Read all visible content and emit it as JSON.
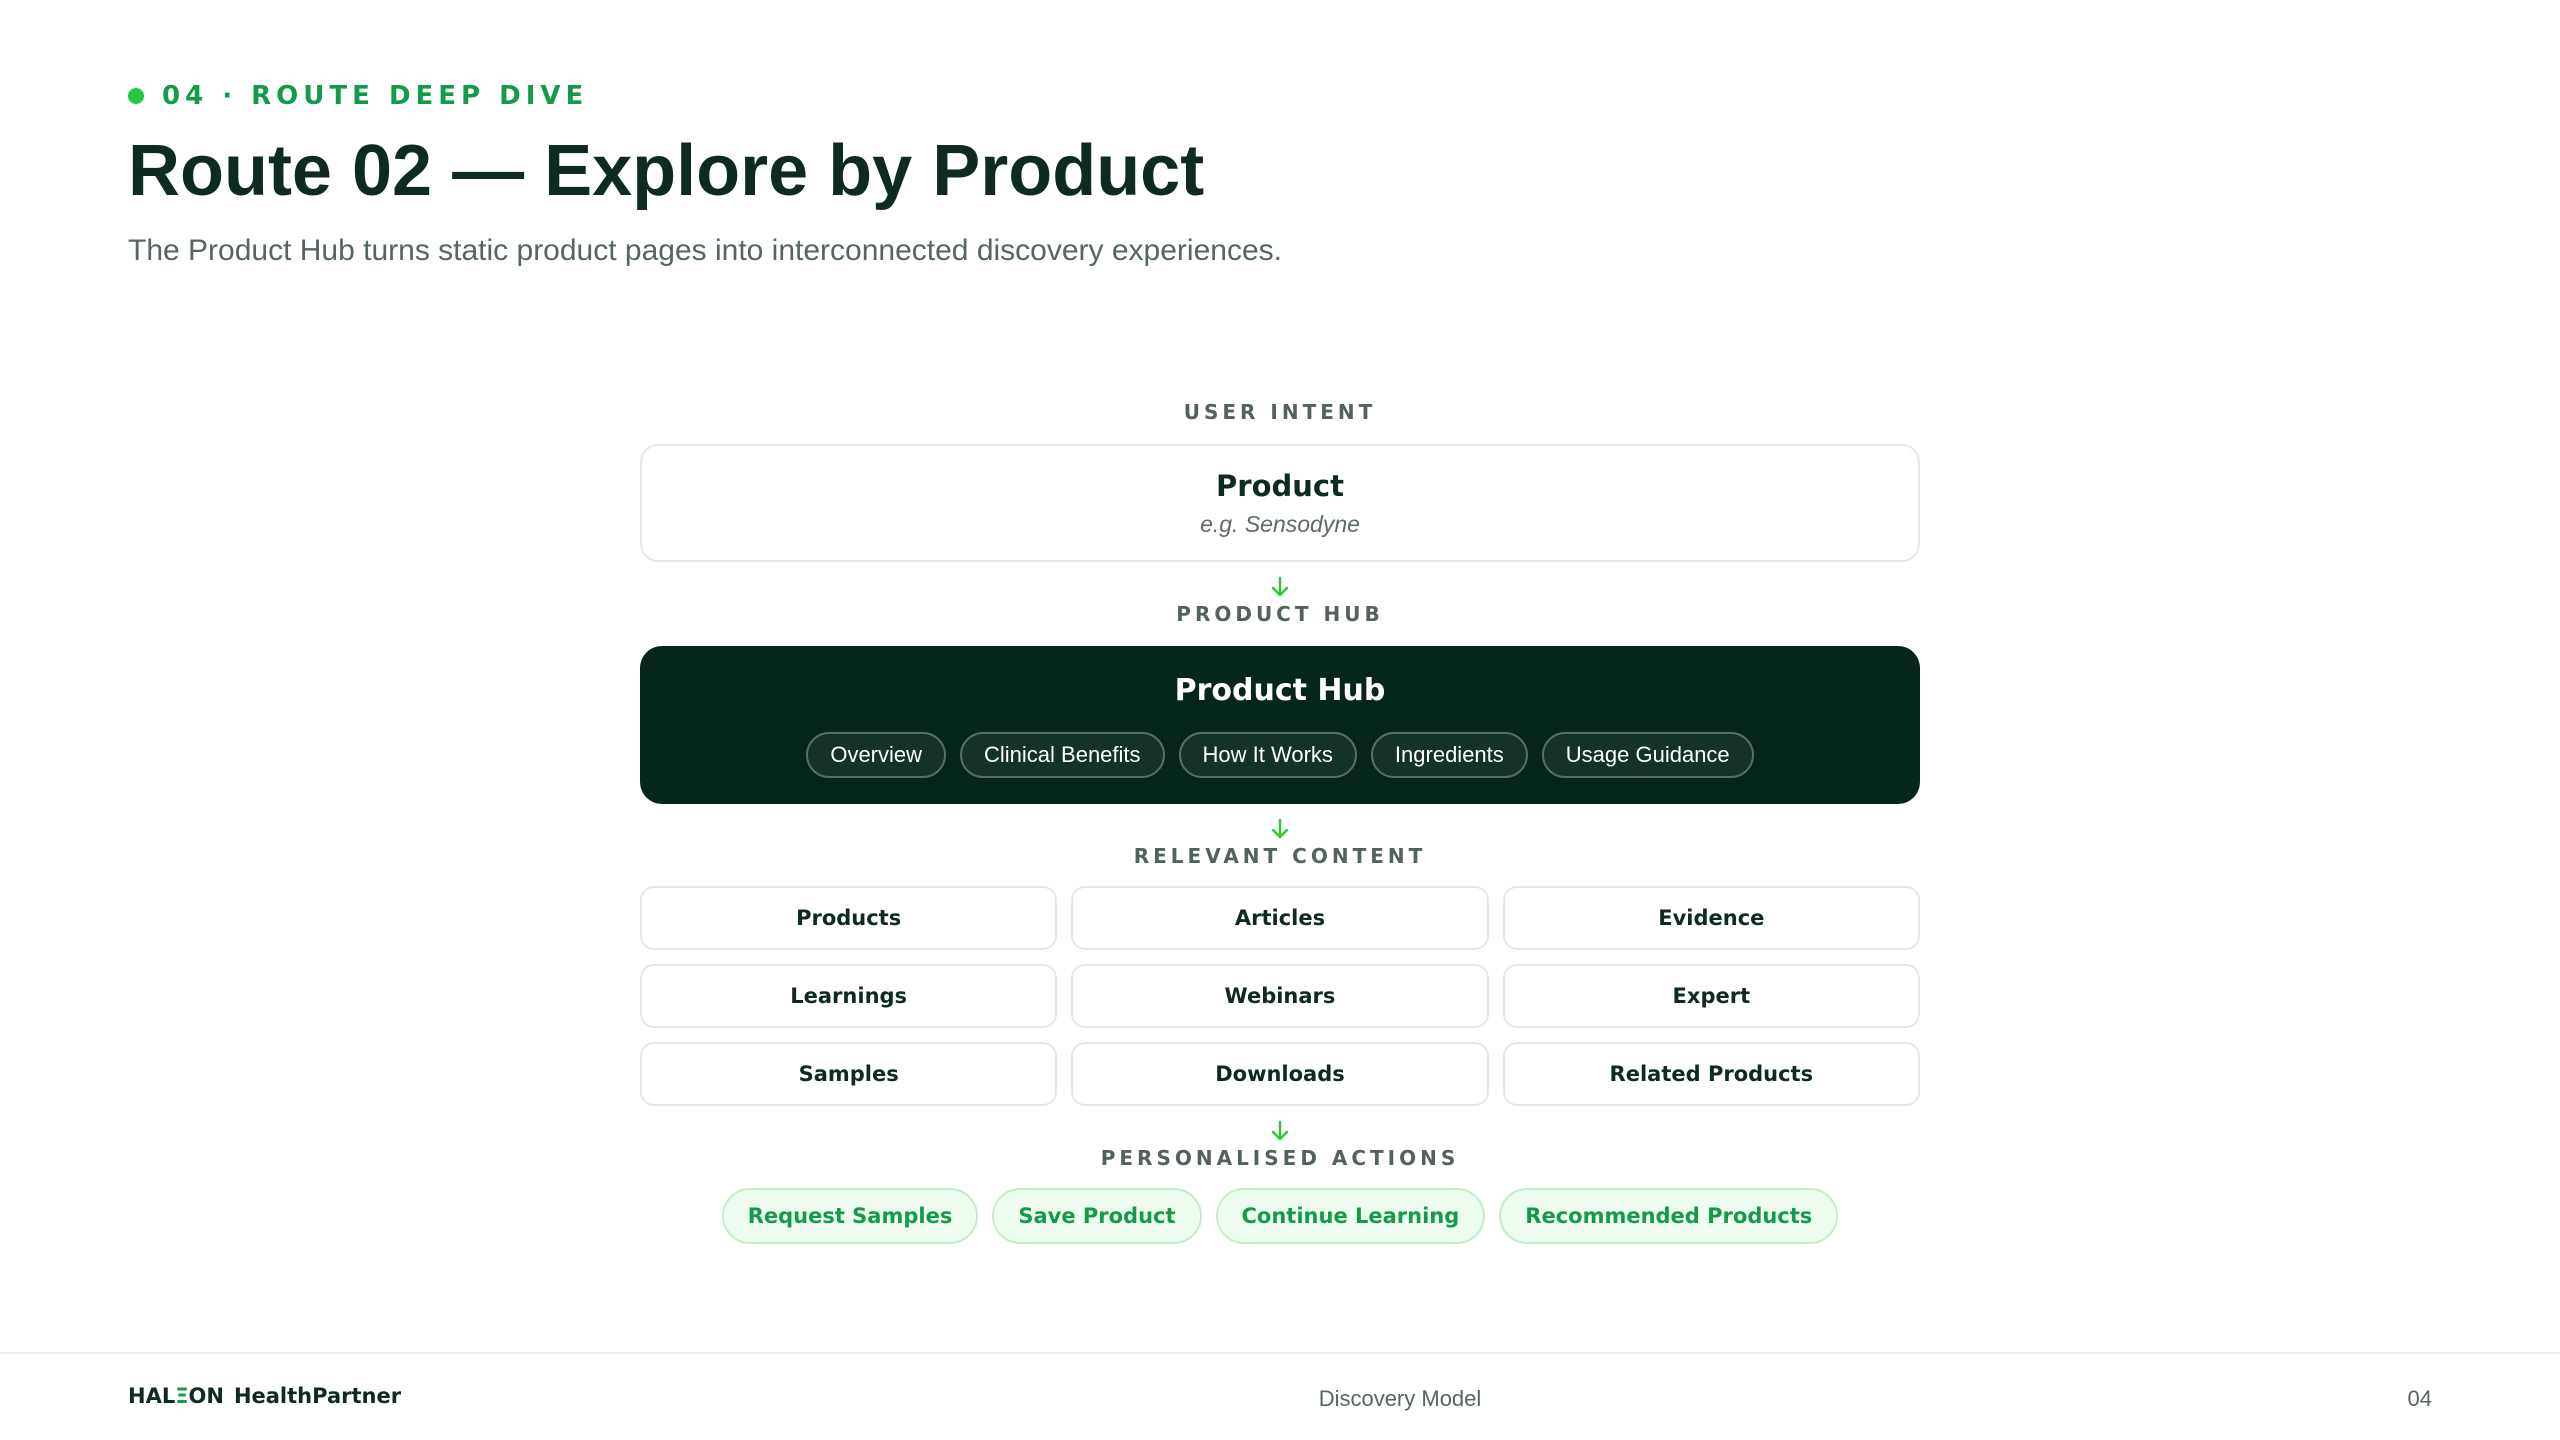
{
  "header": {
    "eyebrow": "04 · ROUTE DEEP DIVE",
    "title": "Route 02 — Explore by Product",
    "subtitle": "The Product Hub turns static product pages into interconnected discovery experiences."
  },
  "diagram": {
    "user_intent": {
      "label": "USER INTENT",
      "title": "Product",
      "example": "e.g. Sensodyne"
    },
    "product_hub": {
      "label": "PRODUCT HUB",
      "title": "Product Hub",
      "chips": [
        "Overview",
        "Clinical Benefits",
        "How It Works",
        "Ingredients",
        "Usage Guidance"
      ]
    },
    "relevant_content": {
      "label": "RELEVANT CONTENT",
      "items": [
        "Products",
        "Articles",
        "Evidence",
        "Learnings",
        "Webinars",
        "Expert",
        "Samples",
        "Downloads",
        "Related Products"
      ]
    },
    "personalised_actions": {
      "label": "PERSONALISED ACTIONS",
      "items": [
        "Request Samples",
        "Save Product",
        "Continue Learning",
        "Recommended Products"
      ]
    }
  },
  "footer": {
    "brand_a": "HAL",
    "brand_e": "Ξ",
    "brand_b": "ON",
    "brand_product": "HealthPartner",
    "center": "Discovery Model",
    "page": "04"
  },
  "colors": {
    "accent": "#139b4a",
    "dot": "#25c93c",
    "hub_bg": "#06261a",
    "text": "#0f2a1e"
  },
  "icons": {
    "flow_arrow": "arrow-down-icon"
  }
}
